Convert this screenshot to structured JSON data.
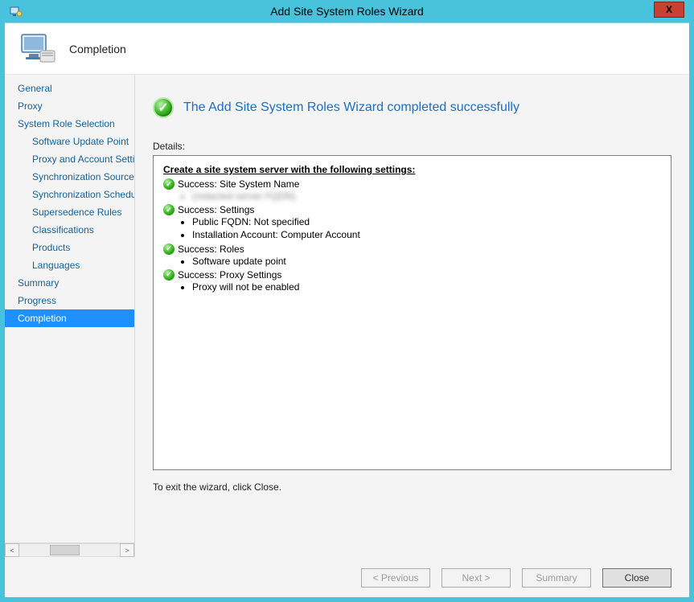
{
  "window": {
    "title": "Add Site System Roles Wizard",
    "close_label": "X"
  },
  "header": {
    "title": "Completion"
  },
  "sidebar": {
    "items": [
      {
        "label": "General",
        "sub": false
      },
      {
        "label": "Proxy",
        "sub": false
      },
      {
        "label": "System Role Selection",
        "sub": false
      },
      {
        "label": "Software Update Point",
        "sub": true
      },
      {
        "label": "Proxy and Account Settings",
        "sub": true
      },
      {
        "label": "Synchronization Source",
        "sub": true
      },
      {
        "label": "Synchronization Schedule",
        "sub": true
      },
      {
        "label": "Supersedence Rules",
        "sub": true
      },
      {
        "label": "Classifications",
        "sub": true
      },
      {
        "label": "Products",
        "sub": true
      },
      {
        "label": "Languages",
        "sub": true
      },
      {
        "label": "Summary",
        "sub": false
      },
      {
        "label": "Progress",
        "sub": false
      },
      {
        "label": "Completion",
        "sub": false,
        "selected": true
      }
    ]
  },
  "main": {
    "success_message": "The Add Site System Roles Wizard completed successfully",
    "details_label": "Details:",
    "settings_heading": "Create a site system server with the following settings:",
    "sections": [
      {
        "title": "Success: Site System Name",
        "bullets": [
          "(redacted server FQDN)"
        ],
        "blurred": true
      },
      {
        "title": "Success: Settings",
        "bullets": [
          "Public FQDN: Not specified",
          "Installation Account: Computer Account"
        ]
      },
      {
        "title": "Success: Roles",
        "bullets": [
          "Software update point"
        ]
      },
      {
        "title": "Success: Proxy Settings",
        "bullets": [
          "Proxy will not be enabled"
        ]
      }
    ],
    "exit_text": "To exit the wizard, click Close."
  },
  "buttons": {
    "previous": "< Previous",
    "next": "Next >",
    "summary": "Summary",
    "close": "Close"
  }
}
